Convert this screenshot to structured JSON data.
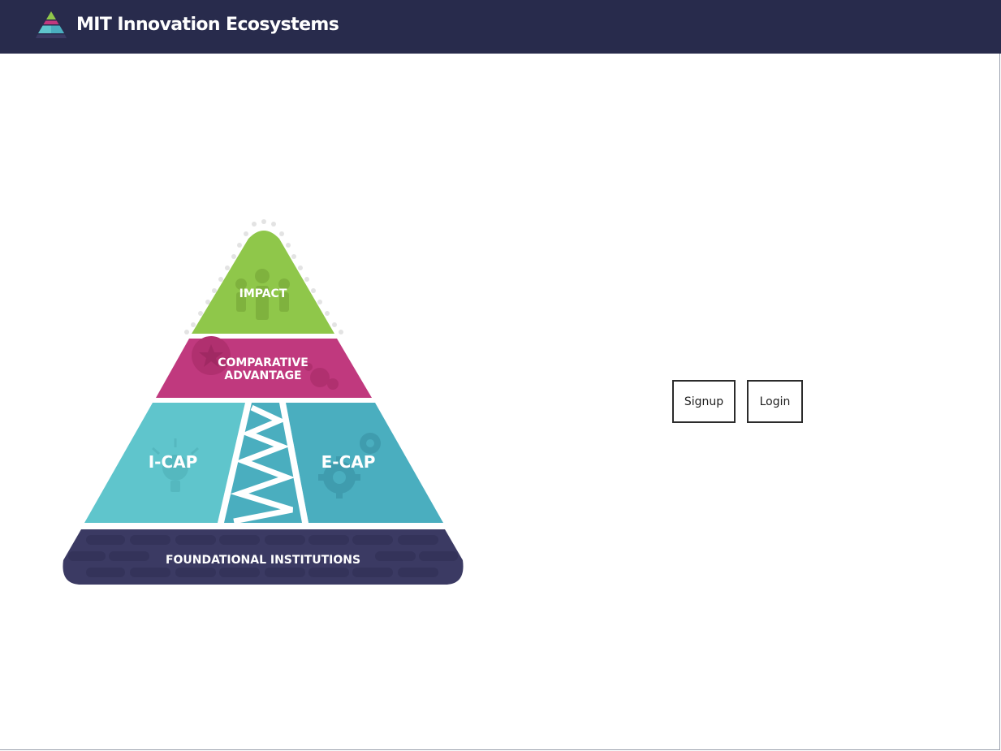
{
  "header": {
    "title": "MIT Innovation Ecosystems",
    "logo_icon": "pyramid-logo-icon",
    "background_color": "#282b4c"
  },
  "pyramid": {
    "tiers": {
      "impact": "IMPACT",
      "comparative_advantage_line1": "COMPARATIVE",
      "comparative_advantage_line2": "ADVANTAGE",
      "icap": "I-CAP",
      "ecap": "E-CAP",
      "foundational": "FOUNDATIONAL INSTITUTIONS"
    },
    "colors": {
      "impact": "#8fc74a",
      "comparative_advantage": "#c0397e",
      "icap": "#5fc5cc",
      "ecap": "#4aaebf",
      "foundational": "#3b3a63"
    }
  },
  "auth": {
    "signup_label": "Signup",
    "login_label": "Login"
  }
}
